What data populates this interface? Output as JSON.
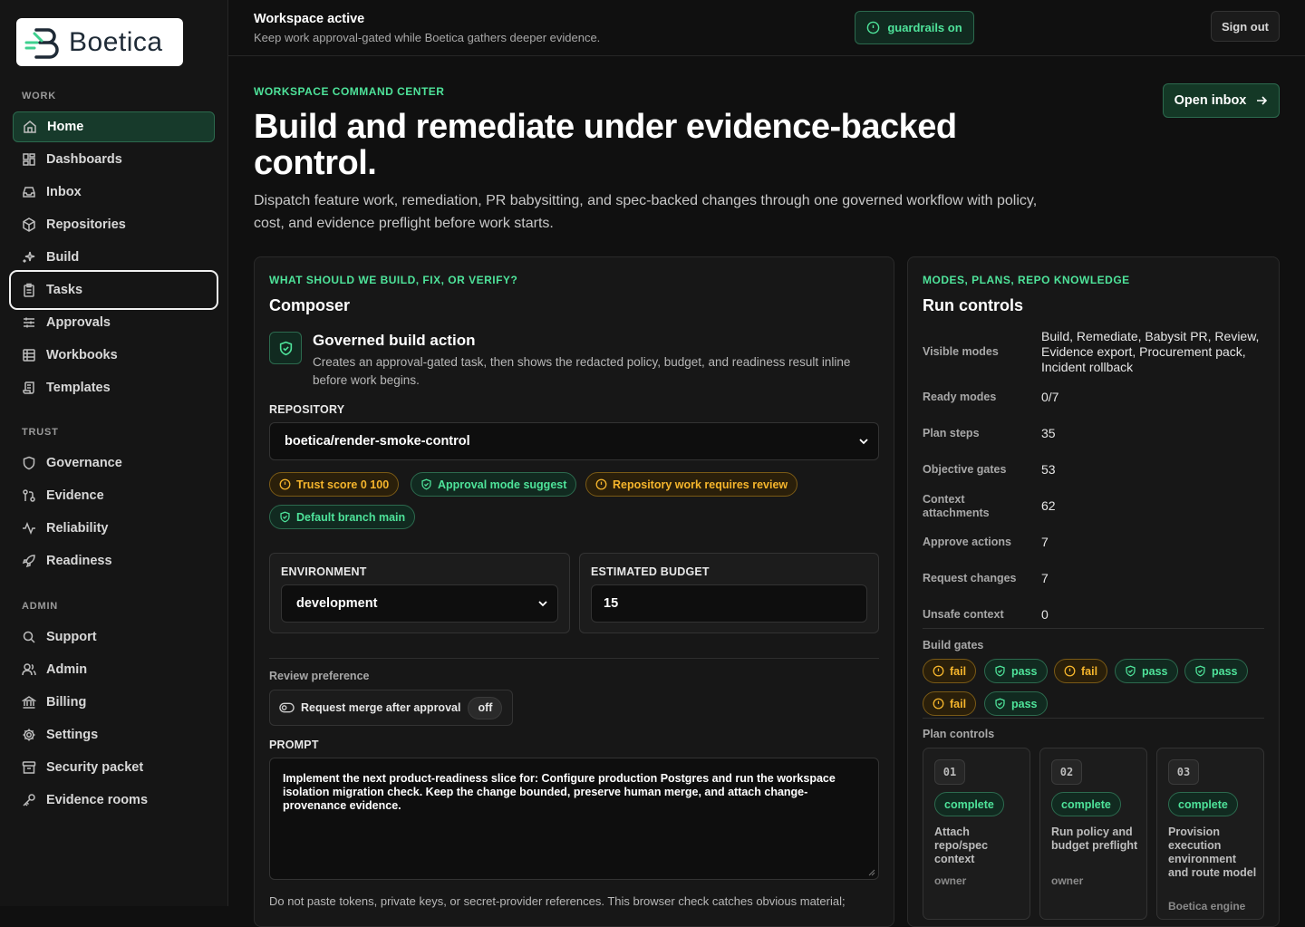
{
  "brand": {
    "name": "Boetica"
  },
  "sidebar": {
    "sections": {
      "work": "WORK",
      "trust": "TRUST",
      "admin": "ADMIN"
    },
    "items": [
      {
        "label": "Home",
        "icon": "home-icon"
      },
      {
        "label": "Dashboards",
        "icon": "dashboard-icon"
      },
      {
        "label": "Inbox",
        "icon": "inbox-icon"
      },
      {
        "label": "Repositories",
        "icon": "box-icon"
      },
      {
        "label": "Build",
        "icon": "sparkle-icon"
      },
      {
        "label": "Tasks",
        "icon": "clipboard-icon"
      },
      {
        "label": "Approvals",
        "icon": "sliders-icon"
      },
      {
        "label": "Workbooks",
        "icon": "table-icon"
      },
      {
        "label": "Templates",
        "icon": "scroll-icon"
      },
      {
        "label": "Governance",
        "icon": "shield-icon"
      },
      {
        "label": "Evidence",
        "icon": "git-compare-icon"
      },
      {
        "label": "Reliability",
        "icon": "activity-icon"
      },
      {
        "label": "Readiness",
        "icon": "rocket-icon"
      },
      {
        "label": "Support",
        "icon": "search-icon"
      },
      {
        "label": "Admin",
        "icon": "users-icon"
      },
      {
        "label": "Billing",
        "icon": "bank-icon"
      },
      {
        "label": "Settings",
        "icon": "gear-icon"
      },
      {
        "label": "Security packet",
        "icon": "archive-icon"
      },
      {
        "label": "Evidence rooms",
        "icon": "key-icon"
      }
    ]
  },
  "topbar": {
    "title": "Workspace active",
    "subtitle": "Keep work approval-gated while Boetica gathers deeper evidence.",
    "guardrails": "guardrails on",
    "signout": "Sign out"
  },
  "hero": {
    "eyebrow": "WORKSPACE COMMAND CENTER",
    "title": "Build and remediate under evidence-backed control.",
    "lead": "Dispatch feature work, remediation, PR babysitting, and spec-backed changes through one governed workflow with policy, cost, and evidence preflight before work starts.",
    "open_inbox": "Open inbox"
  },
  "composer": {
    "eyebrow": "WHAT SHOULD WE BUILD, FIX, OR VERIFY?",
    "title": "Composer",
    "action_title": "Governed build action",
    "action_desc": "Creates an approval-gated task, then shows the redacted policy, budget, and readiness result inline before work begins.",
    "repository_label": "REPOSITORY",
    "repository_value": "boetica/render-smoke-control",
    "chips": [
      {
        "label": "Trust score 0 100",
        "tone": "warn"
      },
      {
        "label": "Approval mode suggest",
        "tone": "ok"
      },
      {
        "label": "Repository work requires review",
        "tone": "warn"
      },
      {
        "label": "Default branch main",
        "tone": "ok"
      }
    ],
    "environment_label": "ENVIRONMENT",
    "environment_value": "development",
    "budget_label": "ESTIMATED BUDGET",
    "budget_value": "15",
    "review_label": "Review preference",
    "merge_toggle_label": "Request merge after approval",
    "merge_toggle_state": "off",
    "prompt_label": "PROMPT",
    "prompt_value": "Implement the next product-readiness slice for: Configure production Postgres and run the workspace isolation migration check. Keep the change bounded, preserve human merge, and attach change-provenance evidence.",
    "prompt_hint": "Do not paste tokens, private keys, or secret-provider references. This browser check catches obvious material;"
  },
  "run_controls": {
    "eyebrow": "MODES, PLANS, REPO KNOWLEDGE",
    "title": "Run controls",
    "rows": [
      {
        "key": "Visible modes",
        "value": "Build, Remediate, Babysit PR, Review, Evidence export, Procurement pack, Incident rollback"
      },
      {
        "key": "Ready modes",
        "value": "0/7"
      },
      {
        "key": "Plan steps",
        "value": "35"
      },
      {
        "key": "Objective gates",
        "value": "53"
      },
      {
        "key": "Context attachments",
        "value": "62"
      },
      {
        "key": "Approve actions",
        "value": "7"
      },
      {
        "key": "Request changes",
        "value": "7"
      },
      {
        "key": "Unsafe context",
        "value": "0"
      }
    ],
    "build_gates_label": "Build gates",
    "gates": [
      "fail",
      "pass",
      "fail",
      "pass",
      "pass",
      "fail",
      "pass"
    ],
    "plan_controls_label": "Plan controls",
    "plans": [
      {
        "num": "01",
        "status": "complete",
        "title": "Attach repo/spec context",
        "owner": "owner"
      },
      {
        "num": "02",
        "status": "complete",
        "title": "Run policy and budget preflight",
        "owner": "owner"
      },
      {
        "num": "03",
        "status": "complete",
        "title": "Provision execution environment and route model",
        "owner": "Boetica engine"
      }
    ]
  }
}
